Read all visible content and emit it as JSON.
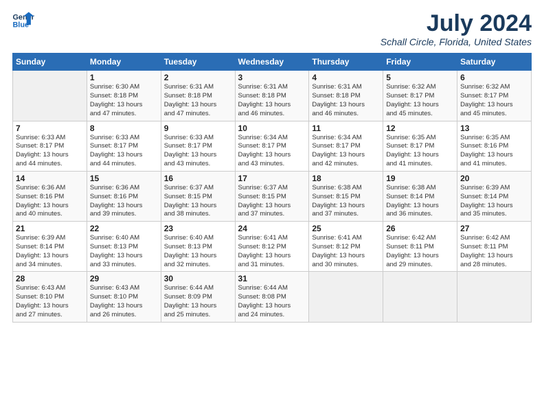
{
  "logo": {
    "line1": "General",
    "line2": "Blue"
  },
  "title": "July 2024",
  "subtitle": "Schall Circle, Florida, United States",
  "days_header": [
    "Sunday",
    "Monday",
    "Tuesday",
    "Wednesday",
    "Thursday",
    "Friday",
    "Saturday"
  ],
  "weeks": [
    [
      {
        "date": "",
        "info": ""
      },
      {
        "date": "1",
        "info": "Sunrise: 6:30 AM\nSunset: 8:18 PM\nDaylight: 13 hours\nand 47 minutes."
      },
      {
        "date": "2",
        "info": "Sunrise: 6:31 AM\nSunset: 8:18 PM\nDaylight: 13 hours\nand 47 minutes."
      },
      {
        "date": "3",
        "info": "Sunrise: 6:31 AM\nSunset: 8:18 PM\nDaylight: 13 hours\nand 46 minutes."
      },
      {
        "date": "4",
        "info": "Sunrise: 6:31 AM\nSunset: 8:18 PM\nDaylight: 13 hours\nand 46 minutes."
      },
      {
        "date": "5",
        "info": "Sunrise: 6:32 AM\nSunset: 8:17 PM\nDaylight: 13 hours\nand 45 minutes."
      },
      {
        "date": "6",
        "info": "Sunrise: 6:32 AM\nSunset: 8:17 PM\nDaylight: 13 hours\nand 45 minutes."
      }
    ],
    [
      {
        "date": "7",
        "info": "Sunrise: 6:33 AM\nSunset: 8:17 PM\nDaylight: 13 hours\nand 44 minutes."
      },
      {
        "date": "8",
        "info": "Sunrise: 6:33 AM\nSunset: 8:17 PM\nDaylight: 13 hours\nand 44 minutes."
      },
      {
        "date": "9",
        "info": "Sunrise: 6:33 AM\nSunset: 8:17 PM\nDaylight: 13 hours\nand 43 minutes."
      },
      {
        "date": "10",
        "info": "Sunrise: 6:34 AM\nSunset: 8:17 PM\nDaylight: 13 hours\nand 43 minutes."
      },
      {
        "date": "11",
        "info": "Sunrise: 6:34 AM\nSunset: 8:17 PM\nDaylight: 13 hours\nand 42 minutes."
      },
      {
        "date": "12",
        "info": "Sunrise: 6:35 AM\nSunset: 8:17 PM\nDaylight: 13 hours\nand 41 minutes."
      },
      {
        "date": "13",
        "info": "Sunrise: 6:35 AM\nSunset: 8:16 PM\nDaylight: 13 hours\nand 41 minutes."
      }
    ],
    [
      {
        "date": "14",
        "info": "Sunrise: 6:36 AM\nSunset: 8:16 PM\nDaylight: 13 hours\nand 40 minutes."
      },
      {
        "date": "15",
        "info": "Sunrise: 6:36 AM\nSunset: 8:16 PM\nDaylight: 13 hours\nand 39 minutes."
      },
      {
        "date": "16",
        "info": "Sunrise: 6:37 AM\nSunset: 8:15 PM\nDaylight: 13 hours\nand 38 minutes."
      },
      {
        "date": "17",
        "info": "Sunrise: 6:37 AM\nSunset: 8:15 PM\nDaylight: 13 hours\nand 37 minutes."
      },
      {
        "date": "18",
        "info": "Sunrise: 6:38 AM\nSunset: 8:15 PM\nDaylight: 13 hours\nand 37 minutes."
      },
      {
        "date": "19",
        "info": "Sunrise: 6:38 AM\nSunset: 8:14 PM\nDaylight: 13 hours\nand 36 minutes."
      },
      {
        "date": "20",
        "info": "Sunrise: 6:39 AM\nSunset: 8:14 PM\nDaylight: 13 hours\nand 35 minutes."
      }
    ],
    [
      {
        "date": "21",
        "info": "Sunrise: 6:39 AM\nSunset: 8:14 PM\nDaylight: 13 hours\nand 34 minutes."
      },
      {
        "date": "22",
        "info": "Sunrise: 6:40 AM\nSunset: 8:13 PM\nDaylight: 13 hours\nand 33 minutes."
      },
      {
        "date": "23",
        "info": "Sunrise: 6:40 AM\nSunset: 8:13 PM\nDaylight: 13 hours\nand 32 minutes."
      },
      {
        "date": "24",
        "info": "Sunrise: 6:41 AM\nSunset: 8:12 PM\nDaylight: 13 hours\nand 31 minutes."
      },
      {
        "date": "25",
        "info": "Sunrise: 6:41 AM\nSunset: 8:12 PM\nDaylight: 13 hours\nand 30 minutes."
      },
      {
        "date": "26",
        "info": "Sunrise: 6:42 AM\nSunset: 8:11 PM\nDaylight: 13 hours\nand 29 minutes."
      },
      {
        "date": "27",
        "info": "Sunrise: 6:42 AM\nSunset: 8:11 PM\nDaylight: 13 hours\nand 28 minutes."
      }
    ],
    [
      {
        "date": "28",
        "info": "Sunrise: 6:43 AM\nSunset: 8:10 PM\nDaylight: 13 hours\nand 27 minutes."
      },
      {
        "date": "29",
        "info": "Sunrise: 6:43 AM\nSunset: 8:10 PM\nDaylight: 13 hours\nand 26 minutes."
      },
      {
        "date": "30",
        "info": "Sunrise: 6:44 AM\nSunset: 8:09 PM\nDaylight: 13 hours\nand 25 minutes."
      },
      {
        "date": "31",
        "info": "Sunrise: 6:44 AM\nSunset: 8:08 PM\nDaylight: 13 hours\nand 24 minutes."
      },
      {
        "date": "",
        "info": ""
      },
      {
        "date": "",
        "info": ""
      },
      {
        "date": "",
        "info": ""
      }
    ]
  ]
}
